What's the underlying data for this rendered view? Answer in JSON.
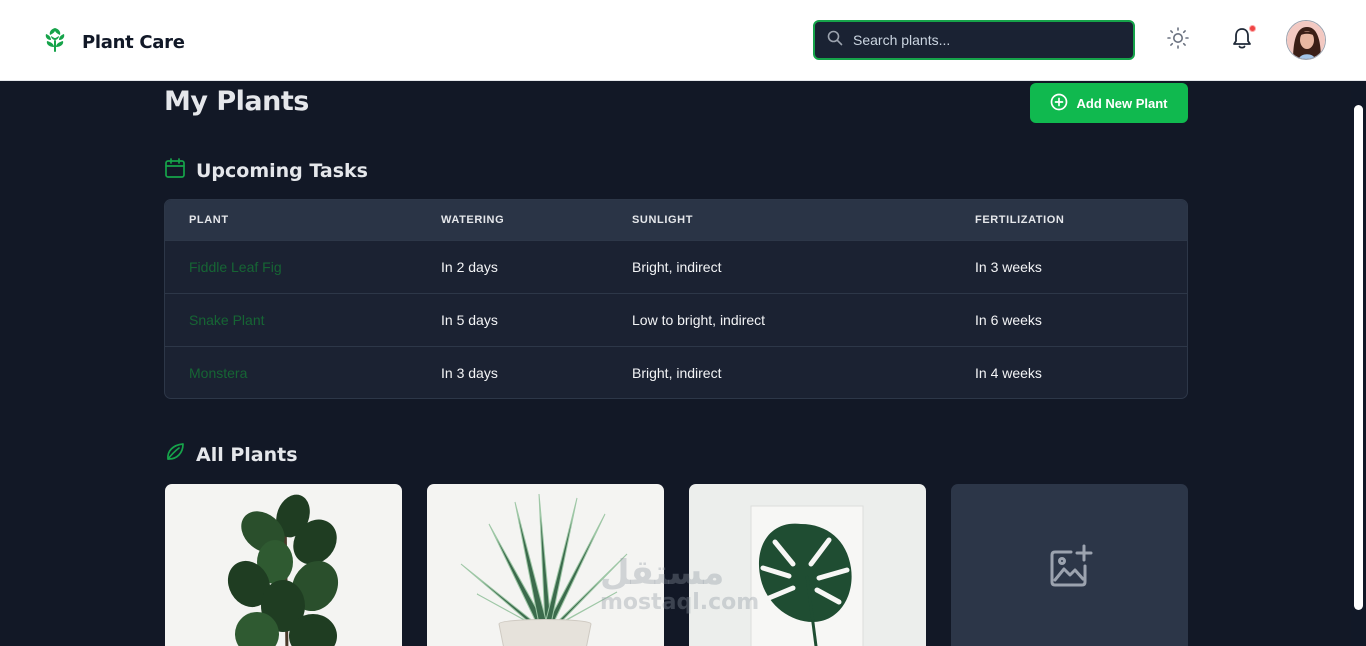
{
  "header": {
    "brand": "Plant Care",
    "search_placeholder": "Search plants...",
    "has_notification": true,
    "accent": "#16a34a"
  },
  "page": {
    "title": "My Plants",
    "add_button": "Add New Plant"
  },
  "tasks": {
    "title": "Upcoming Tasks",
    "columns": [
      "PLANT",
      "WATERING",
      "SUNLIGHT",
      "FERTILIZATION"
    ],
    "rows": [
      {
        "plant": "Fiddle Leaf Fig",
        "watering": "In 2 days",
        "sunlight": "Bright, indirect",
        "fertilization": "In 3 weeks"
      },
      {
        "plant": "Snake Plant",
        "watering": "In 5 days",
        "sunlight": "Low to bright, indirect",
        "fertilization": "In 6 weeks"
      },
      {
        "plant": "Monstera",
        "watering": "In 3 days",
        "sunlight": "Bright, indirect",
        "fertilization": "In 4 weeks"
      }
    ]
  },
  "all_plants": {
    "title": "All Plants",
    "cards": [
      "fiddle-leaf-fig-photo",
      "snake-plant-photo",
      "monstera-photo",
      "add-photo-icon"
    ]
  },
  "watermark": {
    "line1": "مستقل",
    "line2": "mostaql.com"
  }
}
